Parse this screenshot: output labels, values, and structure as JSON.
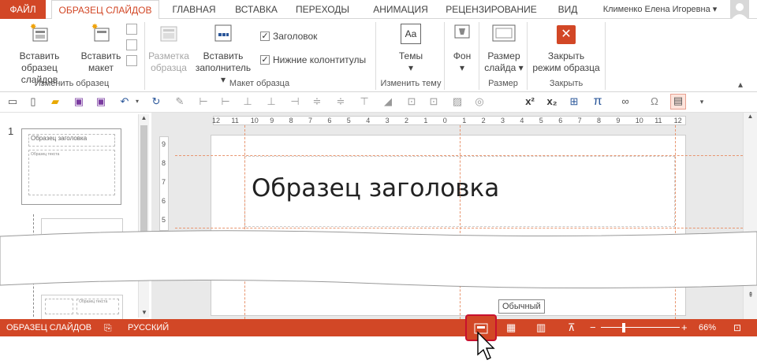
{
  "tabs": {
    "file": "ФАЙЛ",
    "master": "ОБРАЗЕЦ СЛАЙДОВ",
    "home": "ГЛАВНАЯ",
    "insert": "ВСТАВКА",
    "transitions": "ПЕРЕХОДЫ",
    "animation": "АНИМАЦИЯ",
    "review": "РЕЦЕНЗИРОВАНИЕ",
    "view": "ВИД",
    "user": "Клименко Елена Игоревна"
  },
  "ribbon": {
    "insert_master_1": "Вставить",
    "insert_master_2": "образец слайдов",
    "insert_layout_1": "Вставить",
    "insert_layout_2": "макет",
    "group_edit_master": "Изменить образец",
    "master_layout_1": "Разметка",
    "master_layout_2": "образца",
    "insert_placeholder_1": "Вставить",
    "insert_placeholder_2": "заполнитель",
    "title_check": "Заголовок",
    "footers_check": "Нижние колонтитулы",
    "group_master_layout": "Макет образца",
    "themes": "Темы",
    "group_edit_theme": "Изменить тему",
    "background": "Фон",
    "slide_size_1": "Размер",
    "slide_size_2": "слайда",
    "group_size": "Размер",
    "close_1": "Закрыть",
    "close_2": "режим образца",
    "group_close": "Закрыть"
  },
  "slide": {
    "number": "1",
    "thumb_title": "Образец заголовка",
    "thumb_text": "Образец текста",
    "canvas_title": "Образец заголовка"
  },
  "ruler": {
    "h": [
      "12",
      "11",
      "10",
      "9",
      "8",
      "7",
      "6",
      "5",
      "4",
      "3",
      "2",
      "1",
      "0",
      "1",
      "2",
      "3",
      "4",
      "5",
      "6",
      "7",
      "8",
      "9",
      "10",
      "11",
      "12"
    ],
    "v": [
      "9",
      "8",
      "7",
      "6",
      "5"
    ]
  },
  "tooltip": "Обычный",
  "status": {
    "mode": "ОБРАЗЕЦ СЛАЙДОВ",
    "language": "РУССКИЙ",
    "zoom": "66%"
  }
}
